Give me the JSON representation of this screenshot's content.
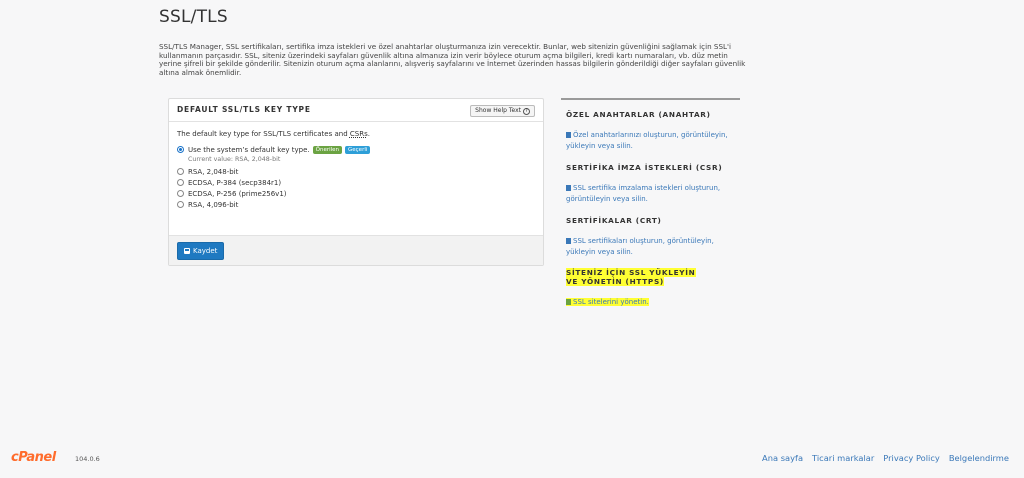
{
  "page": {
    "title": "SSL/TLS",
    "intro": "SSL/TLS Manager, SSL sertifikaları, sertifika imza istekleri ve özel anahtarlar oluşturmanıza izin verecektir. Bunlar, web sitenizin güvenliğini sağlamak için SSL'i kullanmanın parçasıdır. SSL, siteniz üzerindeki sayfaları güvenlik altına almanıza izin verir böylece oturum açma bilgileri, kredi kartı numaraları, vb. düz metin yerine şifreli bir şekilde gönderilir. Sitenizin oturum açma alanlarını, alışveriş sayfalarını ve İnternet üzerinden hassas bilgilerin gönderildiği diğer sayfaları güvenlik altına almak önemlidir."
  },
  "panel": {
    "title": "DEFAULT SSL/TLS KEY TYPE",
    "help_label": "Show Help Text",
    "help_icon": "question-circle-icon",
    "desc_prefix": "The default key type for SSL/TLS certificates and ",
    "desc_abbr": "CSRs",
    "desc_suffix": ".",
    "options": [
      {
        "label": "Use the system’s default key type.",
        "checked": true
      },
      {
        "label": "RSA, 2,048-bit",
        "checked": false
      },
      {
        "label": "ECDSA, P-384 (secp384r1)",
        "checked": false
      },
      {
        "label": "ECDSA, P-256 (prime256v1)",
        "checked": false
      },
      {
        "label": "RSA, 4,096-bit",
        "checked": false
      }
    ],
    "badge_recommended": "Önerilen",
    "badge_current": "Geçerli",
    "current_value": "Current value: RSA, 2,048-bit",
    "save_label": "Kaydet",
    "save_icon": "floppy-disk-icon"
  },
  "sidebar": {
    "sections": [
      {
        "heading": "ÖZEL ANAHTARLAR (ANAHTAR)",
        "link": "Özel anahtarlarınızı oluşturun, görüntüleyin, yükleyin veya silin."
      },
      {
        "heading": "SERTİFİKA İMZA İSTEKLERİ (CSR)",
        "link": "SSL sertifika imzalama istekleri oluşturun, görüntüleyin veya silin."
      },
      {
        "heading": "SERTİFİKALAR (CRT)",
        "link": "SSL sertifikaları oluşturun, görüntüleyin, yükleyin veya silin."
      },
      {
        "heading": "SİTENİZ İÇİN SSL YÜKLEYİN VE YÖNETİN (HTTPS)",
        "link": "SSL sitelerini yönetin."
      }
    ],
    "highlight_color": "#ffff33"
  },
  "footer": {
    "logo": "cPanel",
    "version": "104.0.6",
    "links": [
      "Ana sayfa",
      "Ticari markalar",
      "Privacy Policy",
      "Belgelendirme"
    ]
  },
  "colors": {
    "link": "#3a78b8",
    "primary_button": "#1f79c1",
    "badge_recommended": "#6ba342",
    "badge_current": "#2e9fd8",
    "logo": "#ff6c2c"
  }
}
